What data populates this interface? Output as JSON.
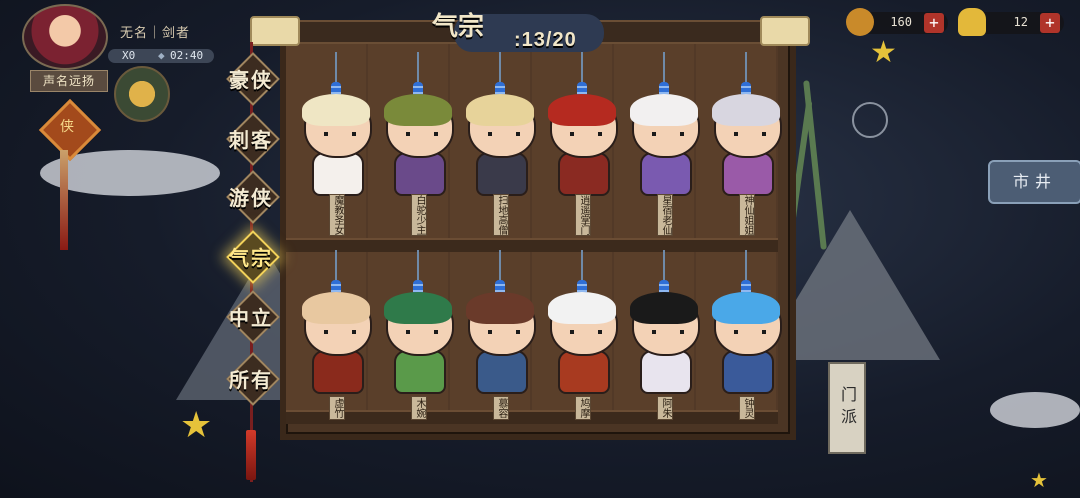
{
  "player": {
    "name": "无名｜剑者",
    "stat_left": "X0",
    "stat_right": "02:40",
    "reputation_label": "声名远扬",
    "charm_text": "侠"
  },
  "currency": [
    {
      "name": "copper-coin",
      "value": "160"
    },
    {
      "name": "gold-ingot",
      "value": "12"
    }
  ],
  "header": {
    "title": "气宗",
    "count": ":13/20"
  },
  "categories": [
    {
      "label": "豪侠",
      "active": false
    },
    {
      "label": "刺客",
      "active": false
    },
    {
      "label": "游侠",
      "active": false
    },
    {
      "label": "气宗",
      "active": true
    },
    {
      "label": "中立",
      "active": false
    },
    {
      "label": "所有",
      "active": false
    }
  ],
  "characters_row1": [
    {
      "name": "魔教圣女",
      "hair": "#efe6c4",
      "body": "#f4f0ec"
    },
    {
      "name": "白驼少主",
      "hair": "#7a8a3a",
      "body": "#6a4a8a"
    },
    {
      "name": "扫地高僧",
      "hair": "#e7d39a",
      "body": "#3a3a4a"
    },
    {
      "name": "逍遥掌门",
      "hair": "#b52a20",
      "body": "#8a2a22"
    },
    {
      "name": "星宿老仙",
      "hair": "#f2f0f0",
      "body": "#7a5ab0"
    },
    {
      "name": "神仙姐姐",
      "hair": "#d8d6e0",
      "body": "#9a5aa8"
    }
  ],
  "characters_row2": [
    {
      "name": "虚竹",
      "hair": "#e8c8a0",
      "body": "#8a2a1c"
    },
    {
      "name": "木婉清",
      "hair": "#2f7a4a",
      "body": "#5a9a4a"
    },
    {
      "name": "慕容复",
      "hair": "#6a3a2a",
      "body": "#3a5a8a"
    },
    {
      "name": "鸠摩智",
      "hair": "#f2f2f2",
      "body": "#a83a20"
    },
    {
      "name": "阿朱",
      "hair": "#1a1a1a",
      "body": "#e8e4ee"
    },
    {
      "name": "钟灵",
      "hair": "#4aa8e8",
      "body": "#3a5a9a"
    }
  ],
  "side": {
    "market": "市井",
    "sect": "门派"
  }
}
